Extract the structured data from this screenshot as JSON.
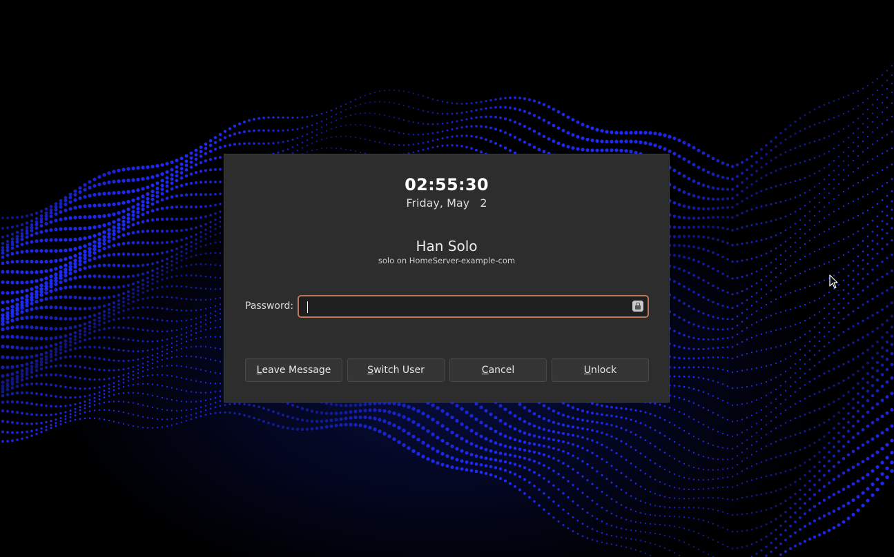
{
  "lockscreen": {
    "time": "02:55:30",
    "date": "Friday, May   2",
    "user_name": "Han Solo",
    "user_host": "solo on HomeServer-example-com",
    "password_label": "Password:",
    "password_value": ""
  },
  "buttons": {
    "leave_message": {
      "mnemonic": "L",
      "rest": "eave Message"
    },
    "switch_user": {
      "mnemonic": "S",
      "rest": "witch User"
    },
    "cancel": {
      "mnemonic": "C",
      "rest": "ancel"
    },
    "unlock": {
      "mnemonic": "U",
      "rest": "nlock"
    }
  },
  "icons": {
    "password_field_icon": "lock-icon",
    "pointer": "mouse-pointer-icon"
  },
  "colors": {
    "dialog_bg": "#2d2d2d",
    "field_focus_border": "#c0785a",
    "wallpaper_dots": "#1f2cff"
  }
}
